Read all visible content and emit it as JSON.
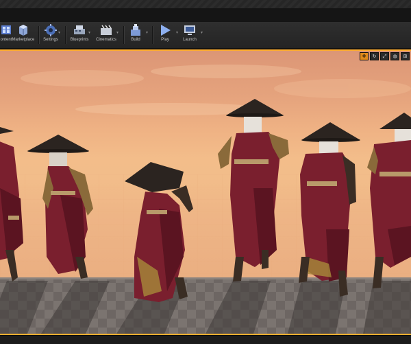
{
  "toolbar": {
    "items": [
      {
        "label": "ontent",
        "icon": "content-browser-icon",
        "has_dropdown": false
      },
      {
        "label": "Marketplace",
        "icon": "marketplace-icon",
        "has_dropdown": false
      },
      {
        "label": "Settings",
        "icon": "settings-icon",
        "has_dropdown": true
      },
      {
        "label": "Blueprints",
        "icon": "blueprints-icon",
        "has_dropdown": true
      },
      {
        "label": "Cinematics",
        "icon": "cinematics-icon",
        "has_dropdown": true
      },
      {
        "label": "Build",
        "icon": "build-icon",
        "has_dropdown": true
      },
      {
        "label": "Play",
        "icon": "play-icon",
        "has_dropdown": true
      },
      {
        "label": "Launch",
        "icon": "launch-icon",
        "has_dropdown": true
      }
    ]
  },
  "viewport": {
    "controls": [
      {
        "icon": "move-tool-icon",
        "glyph": "✥",
        "active": true
      },
      {
        "icon": "rotate-tool-icon",
        "glyph": "↻",
        "active": false
      },
      {
        "icon": "scale-tool-icon",
        "glyph": "⤢",
        "active": false
      },
      {
        "icon": "globe-icon",
        "glyph": "◍",
        "active": false
      },
      {
        "icon": "snap-icon",
        "glyph": "⊞",
        "active": false
      }
    ]
  },
  "colors": {
    "selection_border": "#ffae2f",
    "robe": "#7a1f2e",
    "hat": "#2b2420",
    "floor": "#6e6763"
  }
}
